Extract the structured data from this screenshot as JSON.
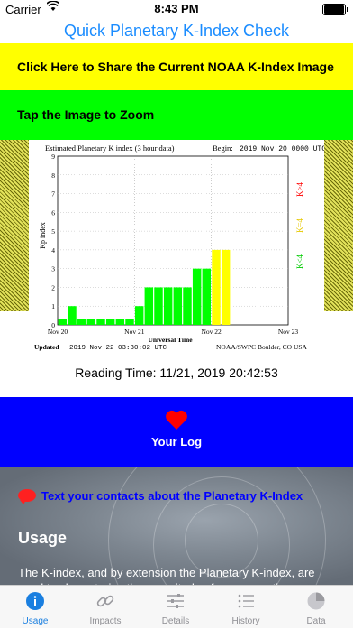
{
  "status_bar": {
    "carrier": "Carrier",
    "time": "8:43 PM"
  },
  "app_title": "Quick Planetary K-Index Check",
  "share_banner": "Click Here to Share the Current NOAA K-Index Image",
  "zoom_banner": "Tap the Image to Zoom",
  "chart_data": {
    "type": "bar",
    "title": "Estimated Planetary K index (3 hour data)",
    "begin_label": "Begin:",
    "begin_value": "2019 Nov 20 0000 UTC",
    "ylabel": "Kp index",
    "xlabel": "Universal Time",
    "ylim": [
      0,
      9
    ],
    "yticks": [
      "0",
      "1",
      "2",
      "3",
      "4",
      "5",
      "6",
      "7",
      "8",
      "9"
    ],
    "xticks": [
      "Nov 20",
      "Nov 21",
      "Nov 22",
      "Nov 23"
    ],
    "values": [
      0.33,
      1,
      0.33,
      0.33,
      0.33,
      0.33,
      0.33,
      0.33,
      1,
      2,
      2,
      2,
      2,
      2,
      3,
      3,
      4,
      4
    ],
    "colors": [
      "#00ff00",
      "#00ff00",
      "#00ff00",
      "#00ff00",
      "#00ff00",
      "#00ff00",
      "#00ff00",
      "#00ff00",
      "#00ff00",
      "#00ff00",
      "#00ff00",
      "#00ff00",
      "#00ff00",
      "#00ff00",
      "#00ff00",
      "#00ff00",
      "#ffff00",
      "#ffff00"
    ],
    "legend": [
      {
        "label": "K<4",
        "color": "#00cc00"
      },
      {
        "label": "K=4",
        "color": "#e6c800"
      },
      {
        "label": "K>4",
        "color": "#ff0000"
      }
    ],
    "updated_label": "Updated",
    "updated_value": "2019 Nov 22 03:30:02 UTC",
    "source": "NOAA/SWPC Boulder, CO USA"
  },
  "reading_time": "Reading Time: 11/21, 2019 20:42:53",
  "log_button": "Your Log",
  "text_contacts": "Text your contacts about the Planetary K-Index",
  "usage_heading": "Usage",
  "usage_body": "The K-index, and by extension the Planetary K-index, are used to characterize the magnitude of geomagnetic",
  "tabs": [
    {
      "label": "Usage",
      "icon": "info-icon"
    },
    {
      "label": "Impacts",
      "icon": "link-icon"
    },
    {
      "label": "Details",
      "icon": "sliders-icon"
    },
    {
      "label": "History",
      "icon": "list-icon"
    },
    {
      "label": "Data",
      "icon": "pie-chart-icon"
    }
  ],
  "colors": {
    "accent": "#1a7fe0",
    "share_banner_bg": "#ffff00",
    "zoom_banner_bg": "#00ff00",
    "log_panel_bg": "#0000ff",
    "heart": "#ff0000",
    "contacts_link": "#0000ff"
  }
}
